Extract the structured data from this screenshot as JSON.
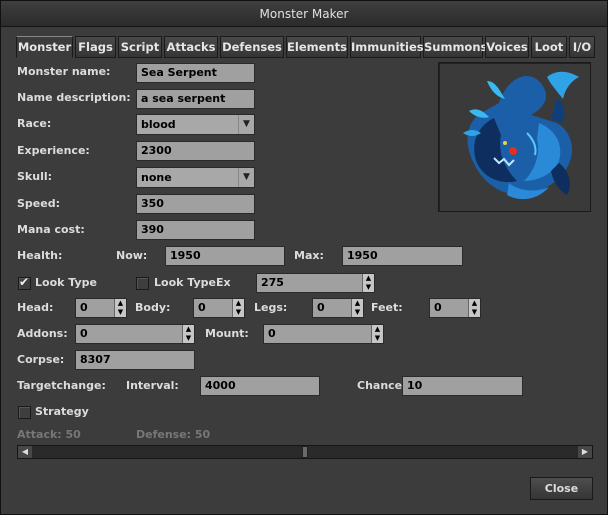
{
  "window": {
    "title": "Monster Maker"
  },
  "tabs": [
    "Monster",
    "Flags",
    "Script",
    "Attacks",
    "Defenses",
    "Elements",
    "Immunities",
    "Summons",
    "Voices",
    "Loot",
    "I/O"
  ],
  "fields": {
    "name": {
      "label": "Monster name:",
      "value": "Sea Serpent"
    },
    "description": {
      "label": "Name description:",
      "value": "a sea serpent"
    },
    "race": {
      "label": "Race:",
      "value": "blood"
    },
    "experience": {
      "label": "Experience:",
      "value": "2300"
    },
    "skull": {
      "label": "Skull:",
      "value": "none"
    },
    "speed": {
      "label": "Speed:",
      "value": "350"
    },
    "mana": {
      "label": "Mana cost:",
      "value": "390"
    }
  },
  "health": {
    "label": "Health:",
    "now_label": "Now:",
    "now": "1950",
    "max_label": "Max:",
    "max": "1950"
  },
  "look": {
    "look_type_label": "Look Type",
    "look_type_checked": true,
    "look_typeex_label": "Look TypeEx",
    "look_typeex_checked": false,
    "look_type_value": "275"
  },
  "outfit": {
    "head_label": "Head:",
    "head": "0",
    "body_label": "Body:",
    "body": "0",
    "legs_label": "Legs:",
    "legs": "0",
    "feet_label": "Feet:",
    "feet": "0"
  },
  "addons": {
    "label": "Addons:",
    "value": "0",
    "mount_label": "Mount:",
    "mount": "0"
  },
  "corpse": {
    "label": "Corpse:",
    "value": "8307"
  },
  "targetchange": {
    "label": "Targetchange:",
    "interval_label": "Interval:",
    "interval": "4000",
    "chance_label": "Chance:",
    "chance": "10"
  },
  "strategy": {
    "label": "Strategy",
    "checked": false,
    "attack_label": "Attack: 50",
    "defense_label": "Defense: 50",
    "slider_position": 0.5
  },
  "buttons": {
    "close": "Close"
  }
}
